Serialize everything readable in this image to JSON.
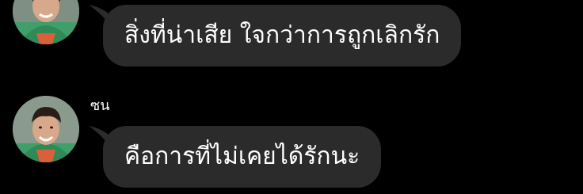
{
  "colors": {
    "background": "#000000",
    "bubble": "#2b2b2b",
    "text": "#ffffff"
  },
  "messages": [
    {
      "sender": "",
      "text": "สิ่งที่น่าเสีย ใจกว่าการถูกเลิกรัก",
      "avatar_icon": "profile-photo"
    },
    {
      "sender": "ซน",
      "text": "คือการที่ไม่เคยได้รักนะ",
      "avatar_icon": "profile-photo"
    }
  ]
}
